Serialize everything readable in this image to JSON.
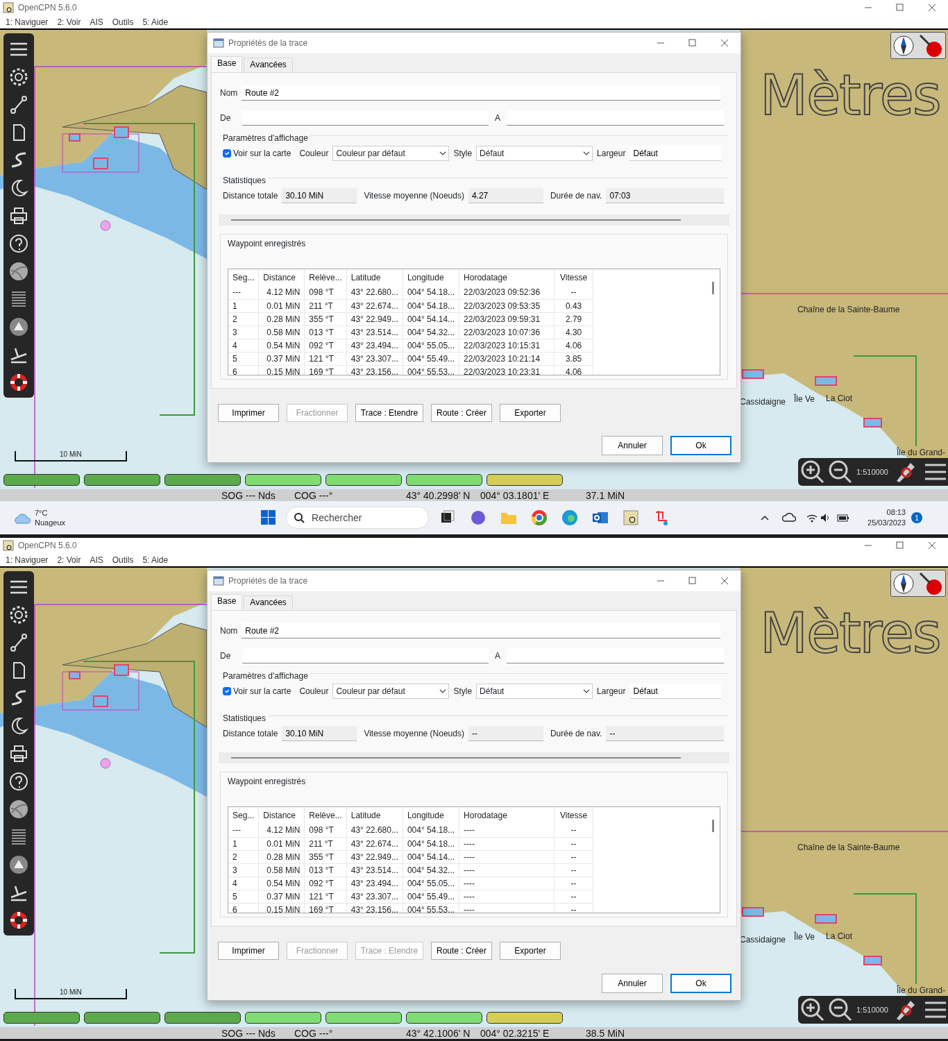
{
  "screens": [
    {
      "window": {
        "title": "OpenCPN 5.6.0"
      },
      "menu": [
        "1: Naviguer",
        "2: Voir",
        "AIS",
        "Outils",
        "5: Aide"
      ],
      "map": {
        "big_label": "Mètres",
        "labels": [
          "Chaîne de la Sainte-Baume",
          "Cassidaigne",
          "Île Ve",
          "La Ciot",
          "Île du Grand-"
        ],
        "scale": "10 MiN",
        "zoom_scale": "1:510000"
      },
      "chart_bar": [
        {
          "color": "#5caa4c"
        },
        {
          "color": "#5caa4c"
        },
        {
          "color": "#5caa4c"
        },
        {
          "color": "#80dc72"
        },
        {
          "color": "#80dc72"
        },
        {
          "color": "#80dc72"
        },
        {
          "color": "#d6cd58"
        }
      ],
      "dialog": {
        "title": "Propriétés de la trace",
        "tabs": [
          {
            "label": "Base",
            "selected": true
          },
          {
            "label": "Avancées",
            "selected": false
          }
        ],
        "name_label": "Nom",
        "name_value": "Route #2",
        "from_label": "De",
        "to_label": "A",
        "display_group": "Paramètres d'affichage",
        "show_on_chart": {
          "label": "Voir sur la carte",
          "checked": true
        },
        "color_label": "Couleur",
        "color_value": "Couleur par défaut",
        "style_label": "Style",
        "style_value": "Défaut",
        "width_label": "Largeur",
        "width_value": "Défaut",
        "stats_group": "Statistiques",
        "stats": [
          {
            "label": "Distance totale",
            "value": "30.10 MiN"
          },
          {
            "label": "Vitesse moyenne (Noeuds)",
            "value": "4.27"
          },
          {
            "label": "Durée de nav.",
            "value": "07:03"
          }
        ],
        "waypoints_group": "Waypoint enregistrés",
        "table": {
          "columns": [
            "Seg...",
            "Distance",
            "Relève...",
            "Latitude",
            "Longitude",
            "Horodatage",
            "Vitesse"
          ],
          "rows": [
            [
              "---",
              "4.12 MiN",
              "098 °T",
              "43° 22.680...",
              "004° 54.18...",
              "22/03/2023 09:52:36",
              "--"
            ],
            [
              "1",
              "0.01 MiN",
              "211 °T",
              "43° 22.674...",
              "004° 54.18...",
              "22/03/2023 09:53:35",
              "0.43"
            ],
            [
              "2",
              "0.28 MiN",
              "355 °T",
              "43° 22.949...",
              "004° 54.14...",
              "22/03/2023 09:59:31",
              "2.79"
            ],
            [
              "3",
              "0.58 MiN",
              "013 °T",
              "43° 23.514...",
              "004° 54.32...",
              "22/03/2023 10:07:36",
              "4.30"
            ],
            [
              "4",
              "0.54 MiN",
              "092 °T",
              "43° 23.494...",
              "004° 55.05...",
              "22/03/2023 10:15:31",
              "4.06"
            ],
            [
              "5",
              "0.37 MiN",
              "121 °T",
              "43° 23.307...",
              "004° 55.49...",
              "22/03/2023 10:21:14",
              "3.85"
            ],
            [
              "6",
              "0.15 MiN",
              "169 °T",
              "43° 23.156...",
              "004° 55.53...",
              "22/03/2023 10:23:31",
              "4.06"
            ]
          ]
        },
        "buttons": [
          {
            "label": "Imprimer",
            "disabled": false
          },
          {
            "label": "Fractionner",
            "disabled": true
          },
          {
            "label": "Trace : Etendre",
            "disabled": false
          },
          {
            "label": "Route : Créer",
            "disabled": false
          },
          {
            "label": "Exporter",
            "disabled": false
          }
        ],
        "actions": [
          {
            "label": "Annuler",
            "default": false
          },
          {
            "label": "Ok",
            "default": true
          }
        ]
      },
      "status_bar": [
        "SOG --- Nds",
        "COG ---°",
        "43° 40.2998' N",
        "004° 03.1801' E",
        "37.1 MiN"
      ]
    },
    {
      "window": {
        "title": "OpenCPN 5.6.0"
      },
      "menu": [
        "1: Naviguer",
        "2: Voir",
        "AIS",
        "Outils",
        "5: Aide"
      ],
      "map": {
        "big_label": "Mètres",
        "labels": [
          "Chaîne de la Sainte-Baume",
          "Cassidaigne",
          "Île Ve",
          "La Ciot",
          "Île du Grand-"
        ],
        "scale": "10 MiN",
        "zoom_scale": "1:510000"
      },
      "chart_bar": [
        {
          "color": "#5caa4c"
        },
        {
          "color": "#5caa4c"
        },
        {
          "color": "#5caa4c"
        },
        {
          "color": "#80dc72"
        },
        {
          "color": "#80dc72"
        },
        {
          "color": "#80dc72"
        },
        {
          "color": "#d6cd58"
        }
      ],
      "dialog": {
        "title": "Propriétés de la trace",
        "tabs": [
          {
            "label": "Base",
            "selected": true
          },
          {
            "label": "Avancées",
            "selected": false
          }
        ],
        "name_label": "Nom",
        "name_value": "Route #2",
        "from_label": "De",
        "to_label": "A",
        "display_group": "Paramètres d'affichage",
        "show_on_chart": {
          "label": "Voir sur la carte",
          "checked": true
        },
        "color_label": "Couleur",
        "color_value": "Couleur par défaut",
        "style_label": "Style",
        "style_value": "Défaut",
        "width_label": "Largeur",
        "width_value": "Défaut",
        "stats_group": "Statistiques",
        "stats": [
          {
            "label": "Distance totale",
            "value": "30.10 MiN"
          },
          {
            "label": "Vitesse moyenne (Noeuds)",
            "value": "--"
          },
          {
            "label": "Durée de nav.",
            "value": "--"
          }
        ],
        "waypoints_group": "Waypoint enregistrés",
        "table": {
          "columns": [
            "Seg...",
            "Distance",
            "Relève...",
            "Latitude",
            "Longitude",
            "Horodatage",
            "Vitesse"
          ],
          "rows": [
            [
              "---",
              "4.12 MiN",
              "098 °T",
              "43° 22.680...",
              "004° 54.18...",
              "----",
              "--"
            ],
            [
              "1",
              "0.01 MiN",
              "211 °T",
              "43° 22.674...",
              "004° 54.18...",
              "----",
              "--"
            ],
            [
              "2",
              "0.28 MiN",
              "355 °T",
              "43° 22.949...",
              "004° 54.14...",
              "----",
              "--"
            ],
            [
              "3",
              "0.58 MiN",
              "013 °T",
              "43° 23.514...",
              "004° 54.32...",
              "----",
              "--"
            ],
            [
              "4",
              "0.54 MiN",
              "092 °T",
              "43° 23.494...",
              "004° 55.05...",
              "----",
              "--"
            ],
            [
              "5",
              "0.37 MiN",
              "121 °T",
              "43° 23.307...",
              "004° 55.49...",
              "----",
              "--"
            ],
            [
              "6",
              "0.15 MiN",
              "169 °T",
              "43° 23.156...",
              "004° 55.53...",
              "----",
              "--"
            ]
          ]
        },
        "buttons": [
          {
            "label": "Imprimer",
            "disabled": false
          },
          {
            "label": "Fractionner",
            "disabled": true
          },
          {
            "label": "Trace : Etendre",
            "disabled": true
          },
          {
            "label": "Route : Créer",
            "disabled": false
          },
          {
            "label": "Exporter",
            "disabled": false
          }
        ],
        "actions": [
          {
            "label": "Annuler",
            "default": false
          },
          {
            "label": "Ok",
            "default": true
          }
        ]
      },
      "status_bar": [
        "SOG --- Nds",
        "COG ---°",
        "43° 42.1006' N",
        "004° 02.3215' E",
        "38.5 MiN"
      ]
    }
  ],
  "taskbar": {
    "temperature": "7°C",
    "weather": "Nuageux",
    "search_placeholder": "Rechercher",
    "time": "08:13",
    "date": "25/03/2023",
    "notifications": "1"
  }
}
